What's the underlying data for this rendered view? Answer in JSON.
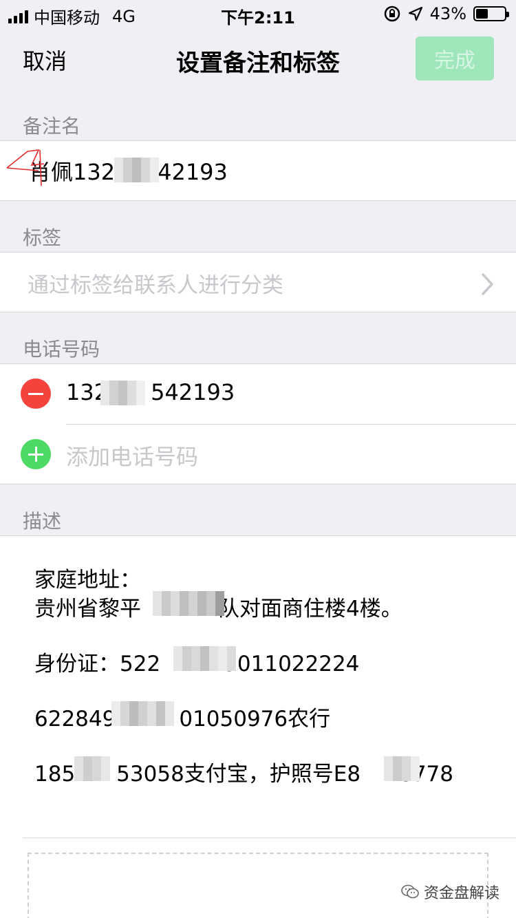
{
  "status_bar": {
    "carrier": "中国移动",
    "network": "4G",
    "time": "下午2:11",
    "battery": "43%"
  },
  "nav": {
    "cancel": "取消",
    "title": "设置备注和标签",
    "done": "完成"
  },
  "remark": {
    "section_label": "备注名",
    "value_prefix": "肖佩132",
    "value_suffix": "42193"
  },
  "tags": {
    "section_label": "标签",
    "placeholder": "通过标签给联系人进行分类"
  },
  "phone": {
    "section_label": "电话号码",
    "number_prefix": "132",
    "number_suffix": "542193",
    "add_placeholder": "添加电话号码"
  },
  "description": {
    "section_label": "描述",
    "line1": "家庭地址：",
    "line2_prefix": "贵州省黎平",
    "line2_suffix": "队对面商住楼4楼。",
    "line3_prefix": "身份证：522",
    "line3_suffix": "9011022224",
    "line4_prefix": "622849",
    "line4_suffix": "01050976农行",
    "line5_prefix": "185",
    "line5_middle": "53058支付宝，护照号E8",
    "line5_suffix": "8778"
  },
  "watermark": "资金盘解读",
  "icons": {
    "remove": "minus-circle-icon",
    "add": "plus-circle-icon",
    "chevron": "chevron-right-icon"
  },
  "colors": {
    "done_button_bg": "#9fe6bb",
    "remove_red": "#f4433d",
    "add_green": "#4cd964",
    "section_gray": "#8a8a8f",
    "placeholder_gray": "#c7c7cc"
  }
}
